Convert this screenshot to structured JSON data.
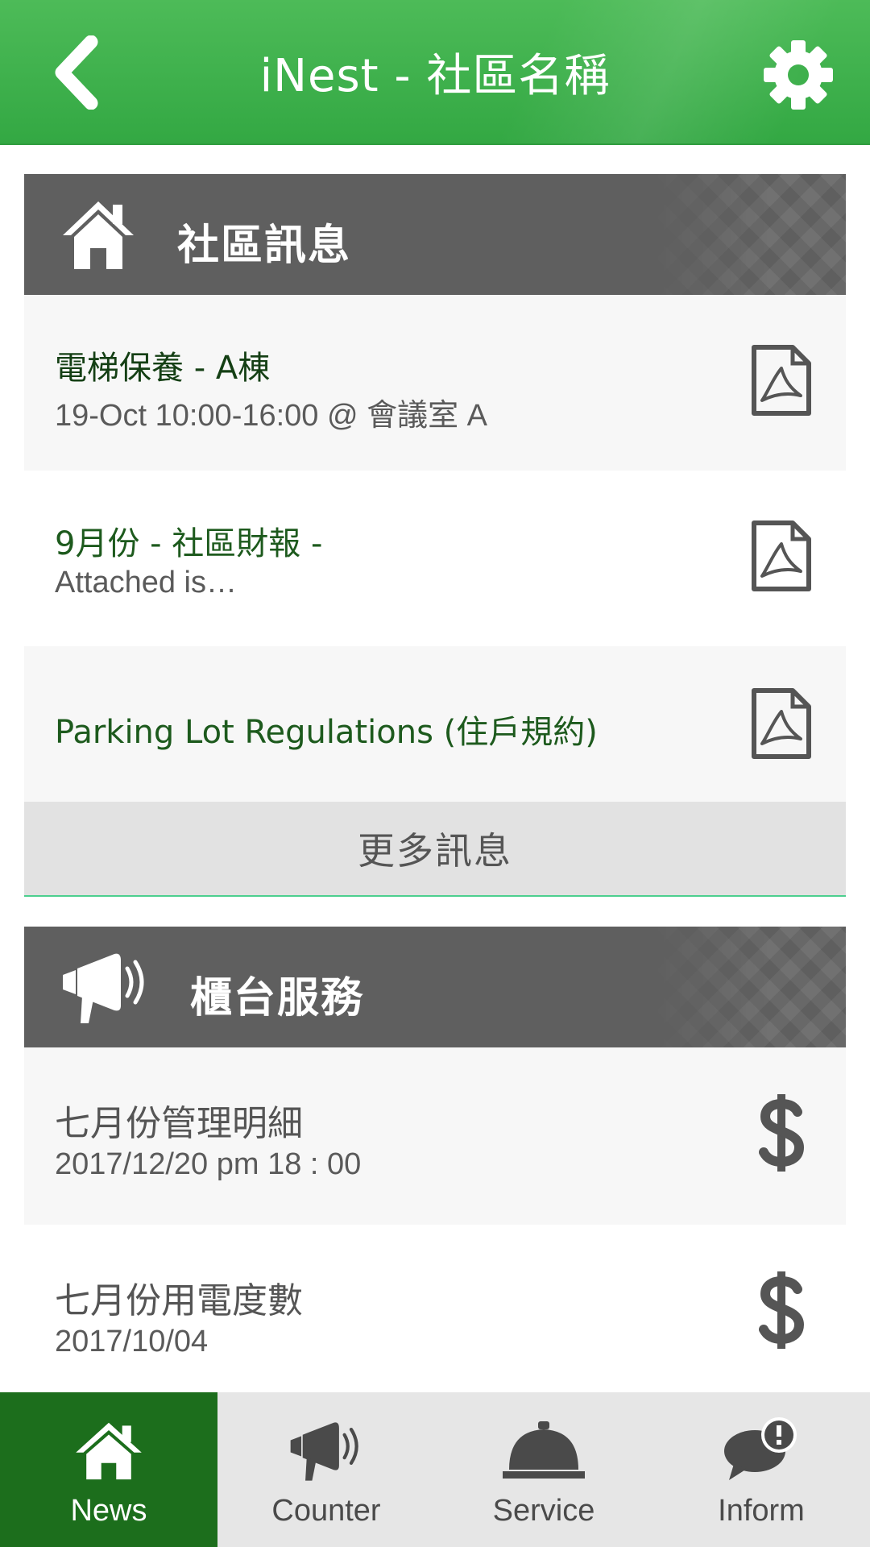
{
  "header": {
    "title": "iNest - 社區名稱",
    "back_icon": "chevron-left-icon",
    "settings_icon": "gear-icon"
  },
  "news_section": {
    "title": "社區訊息",
    "icon": "home-icon",
    "items": [
      {
        "title": "電梯保養 - A棟",
        "subtitle": "19-Oct 10:00-16:00 @ 會議室 A",
        "icon": "pdf-icon"
      },
      {
        "title": "9月份 - 社區財報 -",
        "subtitle": "Attached is…",
        "icon": "pdf-icon"
      },
      {
        "title": "Parking Lot Regulations (住戶規約)",
        "subtitle": "",
        "icon": "pdf-icon"
      }
    ],
    "more_label": "更多訊息"
  },
  "counter_section": {
    "title": "櫃台服務",
    "icon": "megaphone-icon",
    "items": [
      {
        "title": "七月份管理明細",
        "subtitle": "2017/12/20 pm 18 : 00",
        "icon": "dollar-icon"
      },
      {
        "title": "七月份用電度數",
        "subtitle": "2017/10/04",
        "icon": "dollar-icon"
      }
    ]
  },
  "bottom_nav": {
    "tabs": [
      {
        "label": "News",
        "icon": "home-icon",
        "active": true
      },
      {
        "label": "Counter",
        "icon": "megaphone-icon",
        "active": false
      },
      {
        "label": "Service",
        "icon": "service-bell-icon",
        "active": false
      },
      {
        "label": "Inform",
        "icon": "alert-speech-bubble-icon",
        "active": false
      }
    ]
  },
  "colors": {
    "header_green": "#3eb04c",
    "section_gray": "#5f5f5f",
    "active_tab_green": "#1c6e1c",
    "item_title_green": "#1d5a1d"
  }
}
